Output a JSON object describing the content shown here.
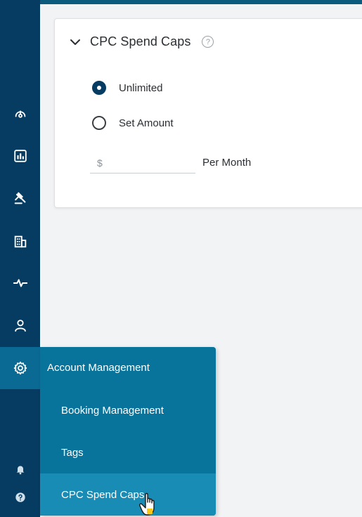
{
  "card": {
    "title": "CPC Spend Caps",
    "help_symbol": "?",
    "options": [
      {
        "label": "Unlimited",
        "checked": true
      },
      {
        "label": "Set Amount",
        "checked": false
      }
    ],
    "amount": {
      "placeholder": "$",
      "value": ""
    },
    "period_label": "Per Month"
  },
  "sidebar": {
    "icons": [
      "gauge-icon",
      "report-icon",
      "gavel-icon",
      "building-icon",
      "activity-icon",
      "user-icon",
      "gear-icon",
      "bell-icon",
      "help-icon"
    ],
    "active": "gear-icon"
  },
  "flyout": {
    "title": "Account Management",
    "items": [
      {
        "label": "Booking Management"
      },
      {
        "label": "Tags"
      },
      {
        "label": "CPC Spend Caps",
        "hover": true
      }
    ]
  },
  "colors": {
    "sidebar": "#063c61",
    "flyout": "#08739b",
    "flyout_hover": "#198cb6",
    "accent": "#063c61"
  }
}
